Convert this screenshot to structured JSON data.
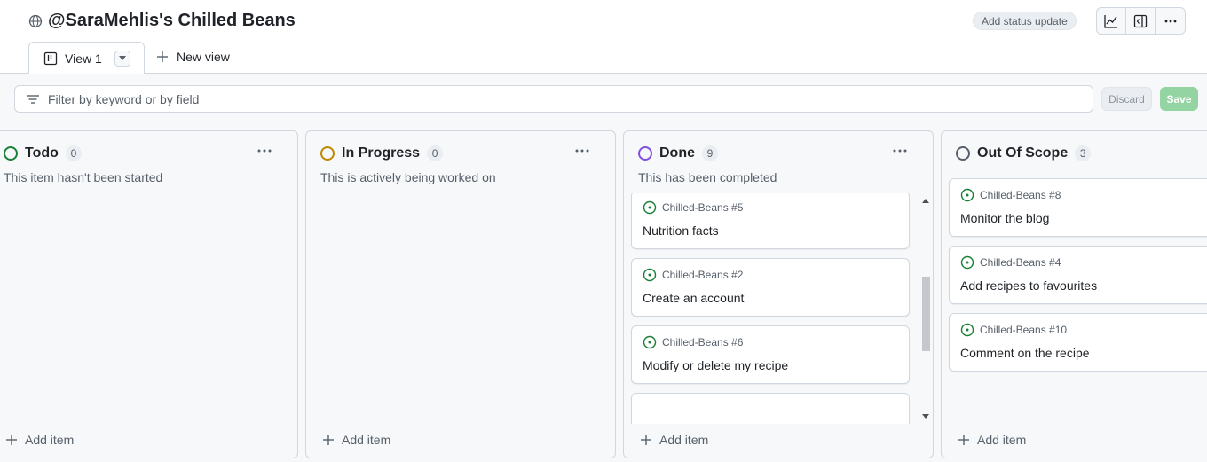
{
  "project": {
    "title": "@SaraMehlis's Chilled Beans",
    "status_button": "Add status update",
    "icons": [
      "insights-icon",
      "sidepanel-icon",
      "kebab-menu-icon"
    ]
  },
  "views": {
    "active_tab": "View 1",
    "new_view": "New view"
  },
  "filter": {
    "placeholder": "Filter by keyword or by field",
    "discard": "Discard",
    "save": "Save"
  },
  "colors": {
    "todo": "#1a7f37",
    "in_progress": "#bf8700",
    "done": "#8250df",
    "out_of_scope": "#57606a",
    "save_bg": "#94d3a2"
  },
  "columns": [
    {
      "name": "Todo",
      "count": "0",
      "description": "This item hasn't been started",
      "add": "Add item",
      "cards": []
    },
    {
      "name": "In Progress",
      "count": "0",
      "description": "This is actively being worked on",
      "add": "Add item",
      "cards": []
    },
    {
      "name": "Done",
      "count": "9",
      "description": "This has been completed",
      "add": "Add item",
      "cards": [
        {
          "ref": "Chilled-Beans #5",
          "title": "Nutrition facts"
        },
        {
          "ref": "Chilled-Beans #2",
          "title": "Create an account"
        },
        {
          "ref": "Chilled-Beans #6",
          "title": "Modify or delete my recipe"
        }
      ]
    },
    {
      "name": "Out Of Scope",
      "count": "3",
      "description": "",
      "add": "Add item",
      "cards": [
        {
          "ref": "Chilled-Beans #8",
          "title": "Monitor the blog"
        },
        {
          "ref": "Chilled-Beans #4",
          "title": "Add recipes to favourites"
        },
        {
          "ref": "Chilled-Beans #10",
          "title": "Comment on the recipe"
        }
      ]
    }
  ]
}
